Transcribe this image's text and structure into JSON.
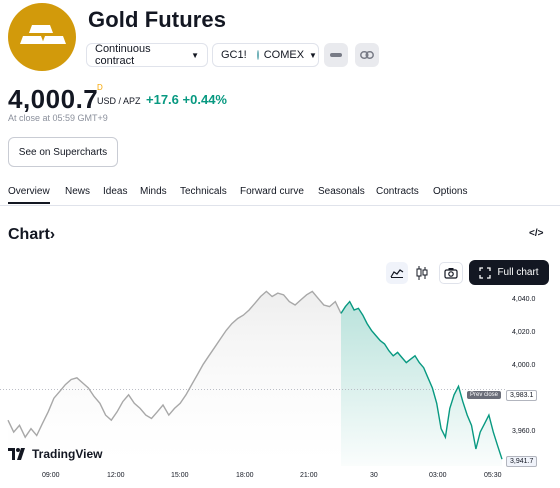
{
  "header": {
    "title": "Gold Futures",
    "contract_selector": "Continuous contract",
    "symbol": "GC1!",
    "exchange": "COMEX"
  },
  "quote": {
    "price": "4,000.7",
    "price_flag": "D",
    "currency": "USD / APZ",
    "change": "+17.6",
    "change_pct": "+0.44%",
    "close_time": "At close at 05:59 GMT+9",
    "supercharts_button": "See on Supercharts"
  },
  "tabs": [
    "Overview",
    "News",
    "Ideas",
    "Minds",
    "Technicals",
    "Forward curve",
    "Seasonals",
    "Contracts",
    "Options"
  ],
  "active_tab": "Overview",
  "chart_section": {
    "heading": "Chart",
    "heading_arrow": "›",
    "embed_icon": "</>",
    "full_chart_button": "Full chart",
    "brand": "TradingView",
    "prev_close_label": "Prev close",
    "prev_close_value": "3,983.1",
    "last_value": "3,941.7"
  },
  "colors": {
    "accent_up": "#089981",
    "logo_bg": "#d29a0b",
    "line_prev_session": "#a8a8a8",
    "line_current_session": "#089981"
  },
  "chart_data": {
    "type": "line",
    "x_ticks": [
      "09:00",
      "12:00",
      "15:00",
      "18:00",
      "21:00",
      "30",
      "03:00",
      "05:30"
    ],
    "y_ticks": [
      "4,040.0",
      "4,020.0",
      "4,000.0",
      "3,960.0"
    ],
    "ylim": [
      3938,
      4043
    ],
    "prev_close": 3983.1,
    "last": 3941.7,
    "series": [
      {
        "values": [
          3965,
          3958,
          3962,
          3955,
          3960,
          3956,
          3963,
          3970,
          3978,
          3982,
          3986,
          3989,
          3990,
          3987,
          3984,
          3979,
          3975,
          3968,
          3965,
          3970,
          3976,
          3980,
          3975,
          3972,
          3968,
          3966,
          3970,
          3974,
          3968,
          3972,
          3975,
          3980,
          3986,
          3992,
          3998,
          4003,
          4008,
          4013,
          4018,
          4022,
          4025,
          4027,
          4030,
          4034,
          4038,
          4041,
          4038,
          4040,
          4039,
          4035,
          4033,
          4036,
          4039,
          4041,
          4037,
          4033,
          4032,
          4035,
          4028
        ]
      },
      {
        "values": [
          4028,
          4032,
          4035,
          4030,
          4031,
          4027,
          4022,
          4018,
          4015,
          4012,
          4010,
          4006,
          4003,
          4005,
          4002,
          3999,
          4001,
          4003,
          3999,
          3996,
          3990,
          3984,
          3975,
          3960,
          3955,
          3972,
          3980,
          3985,
          3976,
          3968,
          3962,
          3948,
          3958,
          3963,
          3968,
          3958,
          3950,
          3942
        ]
      }
    ]
  }
}
